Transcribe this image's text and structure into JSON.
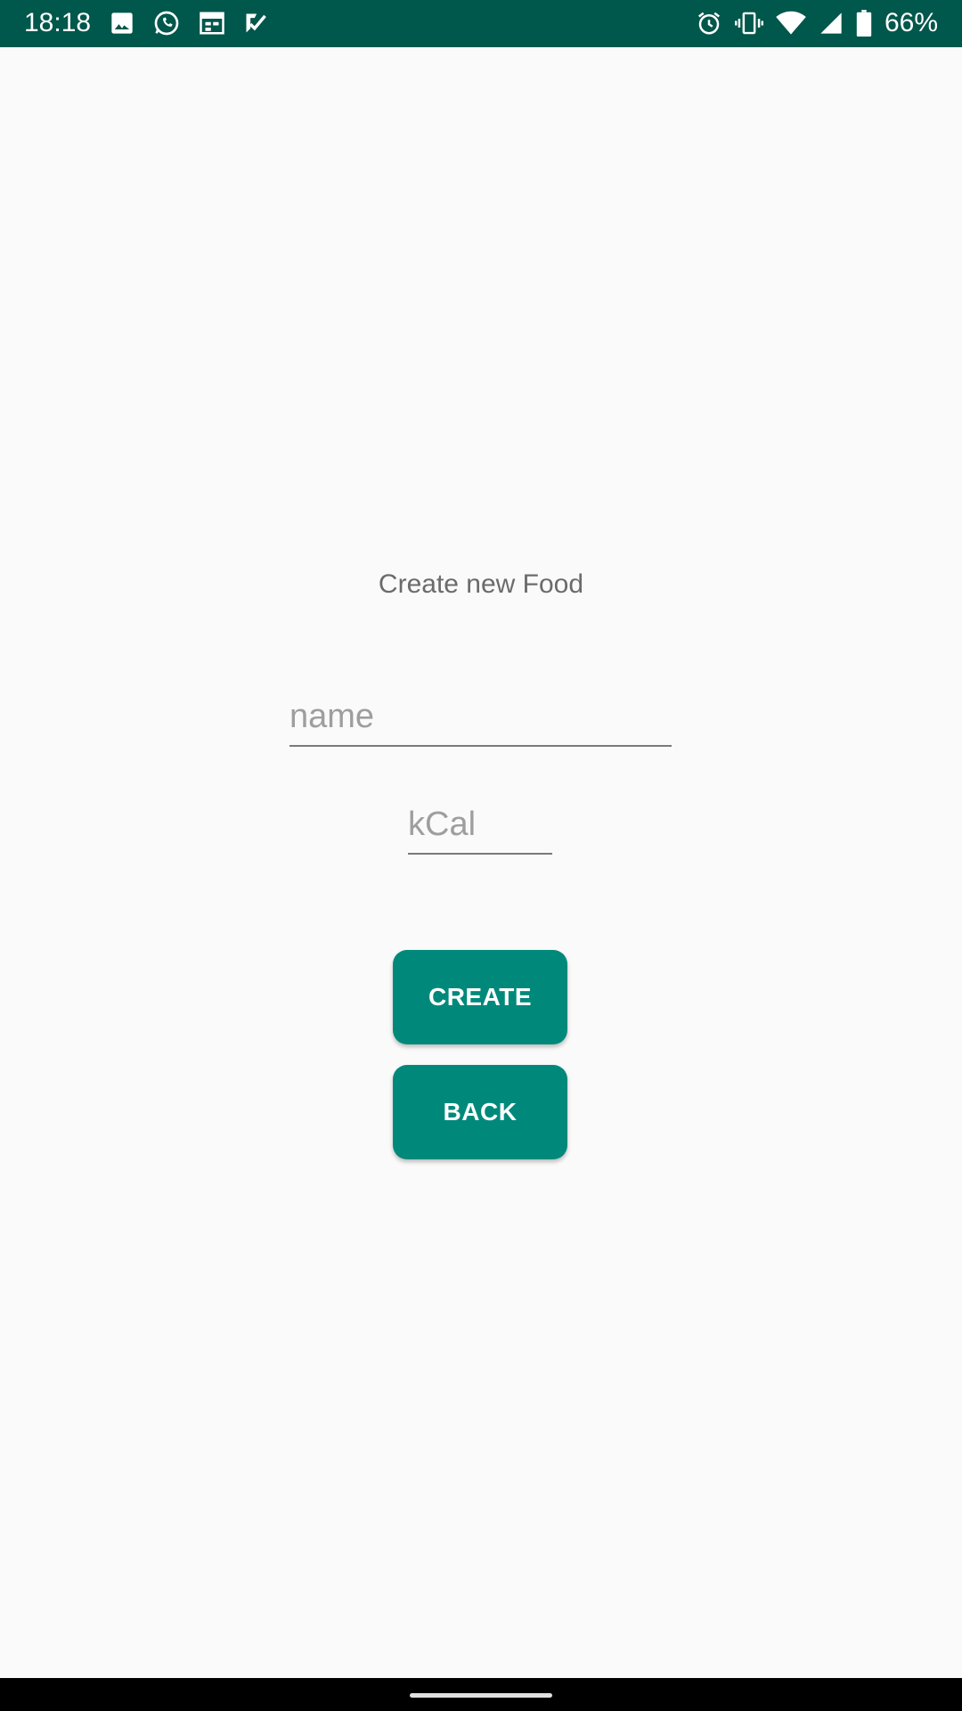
{
  "status_bar": {
    "time": "18:18",
    "left_icons": [
      "image-icon",
      "whatsapp-icon",
      "calendar-icon",
      "check-icon"
    ],
    "right_icons": [
      "alarm-icon",
      "vibrate-icon",
      "wifi-icon",
      "signal-icon",
      "battery-icon"
    ],
    "battery_percent": "66%",
    "background_color": "#00574b"
  },
  "screen": {
    "title": "Create new Food",
    "name_field": {
      "placeholder": "name",
      "value": ""
    },
    "kcal_field": {
      "placeholder": "kCal",
      "value": ""
    },
    "create_button": {
      "label": "CREATE"
    },
    "back_button": {
      "label": "BACK"
    },
    "accent_color": "#00897b"
  }
}
